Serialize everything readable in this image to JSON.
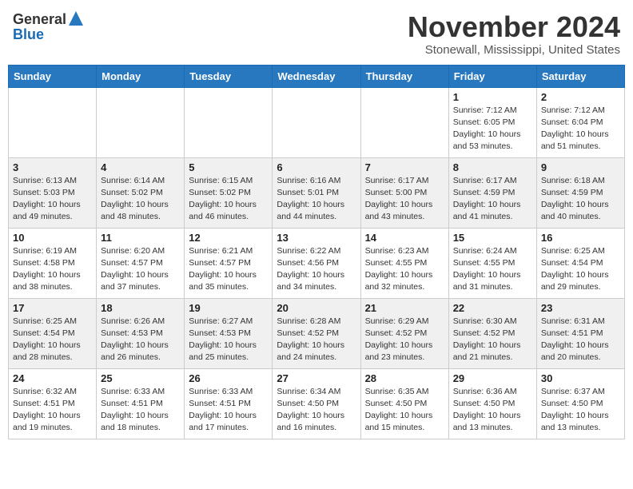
{
  "header": {
    "logo_general": "General",
    "logo_blue": "Blue",
    "month": "November 2024",
    "location": "Stonewall, Mississippi, United States"
  },
  "weekdays": [
    "Sunday",
    "Monday",
    "Tuesday",
    "Wednesday",
    "Thursday",
    "Friday",
    "Saturday"
  ],
  "weeks": [
    [
      {
        "day": "",
        "info": ""
      },
      {
        "day": "",
        "info": ""
      },
      {
        "day": "",
        "info": ""
      },
      {
        "day": "",
        "info": ""
      },
      {
        "day": "",
        "info": ""
      },
      {
        "day": "1",
        "info": "Sunrise: 7:12 AM\nSunset: 6:05 PM\nDaylight: 10 hours\nand 53 minutes."
      },
      {
        "day": "2",
        "info": "Sunrise: 7:12 AM\nSunset: 6:04 PM\nDaylight: 10 hours\nand 51 minutes."
      }
    ],
    [
      {
        "day": "3",
        "info": "Sunrise: 6:13 AM\nSunset: 5:03 PM\nDaylight: 10 hours\nand 49 minutes."
      },
      {
        "day": "4",
        "info": "Sunrise: 6:14 AM\nSunset: 5:02 PM\nDaylight: 10 hours\nand 48 minutes."
      },
      {
        "day": "5",
        "info": "Sunrise: 6:15 AM\nSunset: 5:02 PM\nDaylight: 10 hours\nand 46 minutes."
      },
      {
        "day": "6",
        "info": "Sunrise: 6:16 AM\nSunset: 5:01 PM\nDaylight: 10 hours\nand 44 minutes."
      },
      {
        "day": "7",
        "info": "Sunrise: 6:17 AM\nSunset: 5:00 PM\nDaylight: 10 hours\nand 43 minutes."
      },
      {
        "day": "8",
        "info": "Sunrise: 6:17 AM\nSunset: 4:59 PM\nDaylight: 10 hours\nand 41 minutes."
      },
      {
        "day": "9",
        "info": "Sunrise: 6:18 AM\nSunset: 4:59 PM\nDaylight: 10 hours\nand 40 minutes."
      }
    ],
    [
      {
        "day": "10",
        "info": "Sunrise: 6:19 AM\nSunset: 4:58 PM\nDaylight: 10 hours\nand 38 minutes."
      },
      {
        "day": "11",
        "info": "Sunrise: 6:20 AM\nSunset: 4:57 PM\nDaylight: 10 hours\nand 37 minutes."
      },
      {
        "day": "12",
        "info": "Sunrise: 6:21 AM\nSunset: 4:57 PM\nDaylight: 10 hours\nand 35 minutes."
      },
      {
        "day": "13",
        "info": "Sunrise: 6:22 AM\nSunset: 4:56 PM\nDaylight: 10 hours\nand 34 minutes."
      },
      {
        "day": "14",
        "info": "Sunrise: 6:23 AM\nSunset: 4:55 PM\nDaylight: 10 hours\nand 32 minutes."
      },
      {
        "day": "15",
        "info": "Sunrise: 6:24 AM\nSunset: 4:55 PM\nDaylight: 10 hours\nand 31 minutes."
      },
      {
        "day": "16",
        "info": "Sunrise: 6:25 AM\nSunset: 4:54 PM\nDaylight: 10 hours\nand 29 minutes."
      }
    ],
    [
      {
        "day": "17",
        "info": "Sunrise: 6:25 AM\nSunset: 4:54 PM\nDaylight: 10 hours\nand 28 minutes."
      },
      {
        "day": "18",
        "info": "Sunrise: 6:26 AM\nSunset: 4:53 PM\nDaylight: 10 hours\nand 26 minutes."
      },
      {
        "day": "19",
        "info": "Sunrise: 6:27 AM\nSunset: 4:53 PM\nDaylight: 10 hours\nand 25 minutes."
      },
      {
        "day": "20",
        "info": "Sunrise: 6:28 AM\nSunset: 4:52 PM\nDaylight: 10 hours\nand 24 minutes."
      },
      {
        "day": "21",
        "info": "Sunrise: 6:29 AM\nSunset: 4:52 PM\nDaylight: 10 hours\nand 23 minutes."
      },
      {
        "day": "22",
        "info": "Sunrise: 6:30 AM\nSunset: 4:52 PM\nDaylight: 10 hours\nand 21 minutes."
      },
      {
        "day": "23",
        "info": "Sunrise: 6:31 AM\nSunset: 4:51 PM\nDaylight: 10 hours\nand 20 minutes."
      }
    ],
    [
      {
        "day": "24",
        "info": "Sunrise: 6:32 AM\nSunset: 4:51 PM\nDaylight: 10 hours\nand 19 minutes."
      },
      {
        "day": "25",
        "info": "Sunrise: 6:33 AM\nSunset: 4:51 PM\nDaylight: 10 hours\nand 18 minutes."
      },
      {
        "day": "26",
        "info": "Sunrise: 6:33 AM\nSunset: 4:51 PM\nDaylight: 10 hours\nand 17 minutes."
      },
      {
        "day": "27",
        "info": "Sunrise: 6:34 AM\nSunset: 4:50 PM\nDaylight: 10 hours\nand 16 minutes."
      },
      {
        "day": "28",
        "info": "Sunrise: 6:35 AM\nSunset: 4:50 PM\nDaylight: 10 hours\nand 15 minutes."
      },
      {
        "day": "29",
        "info": "Sunrise: 6:36 AM\nSunset: 4:50 PM\nDaylight: 10 hours\nand 13 minutes."
      },
      {
        "day": "30",
        "info": "Sunrise: 6:37 AM\nSunset: 4:50 PM\nDaylight: 10 hours\nand 13 minutes."
      }
    ]
  ]
}
